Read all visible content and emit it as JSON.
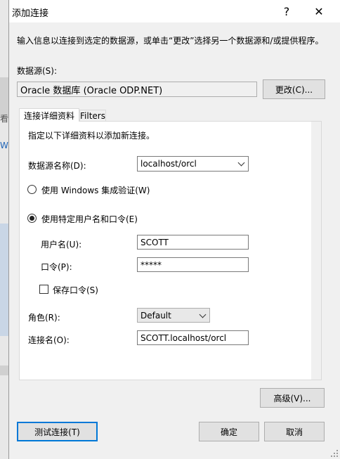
{
  "dialog": {
    "title": "添加连接",
    "help_glyph": "?",
    "close_glyph": "✕"
  },
  "intro_text": "输入信息以连接到选定的数据源，或单击“更改”选择另一个数据源和/或提供程序。",
  "data_source": {
    "label": "数据源(S):",
    "value": "Oracle 数据库 (Oracle ODP.NET)",
    "change_button": "更改(C)..."
  },
  "tabs": [
    {
      "label": "连接详细资料",
      "active": true
    },
    {
      "label": "Filters",
      "active": false
    }
  ],
  "connection": {
    "instruction": "指定以下详细资料以添加新连接。",
    "ds_name_label": "数据源名称(D):",
    "ds_name_value": "localhost/orcl",
    "windows_auth_label": "使用 Windows 集成验证(W)",
    "specific_user_label": "使用特定用户名和口令(E)",
    "auth_mode": "specific_user",
    "username_label": "用户名(U):",
    "username_value": "SCOTT",
    "password_label": "口令(P):",
    "password_value": "*****",
    "save_password_label": "保存口令(S)",
    "save_password_checked": false,
    "role_label": "角色(R):",
    "role_value": "Default",
    "conn_name_label": "连接名(O):",
    "conn_name_value": "SCOTT.localhost/orcl"
  },
  "buttons": {
    "advanced": "高级(V)...",
    "test": "测试连接(T)",
    "ok": "确定",
    "cancel": "取消"
  },
  "background_strip_glyphs": {
    "a": "看",
    "b": "W"
  }
}
